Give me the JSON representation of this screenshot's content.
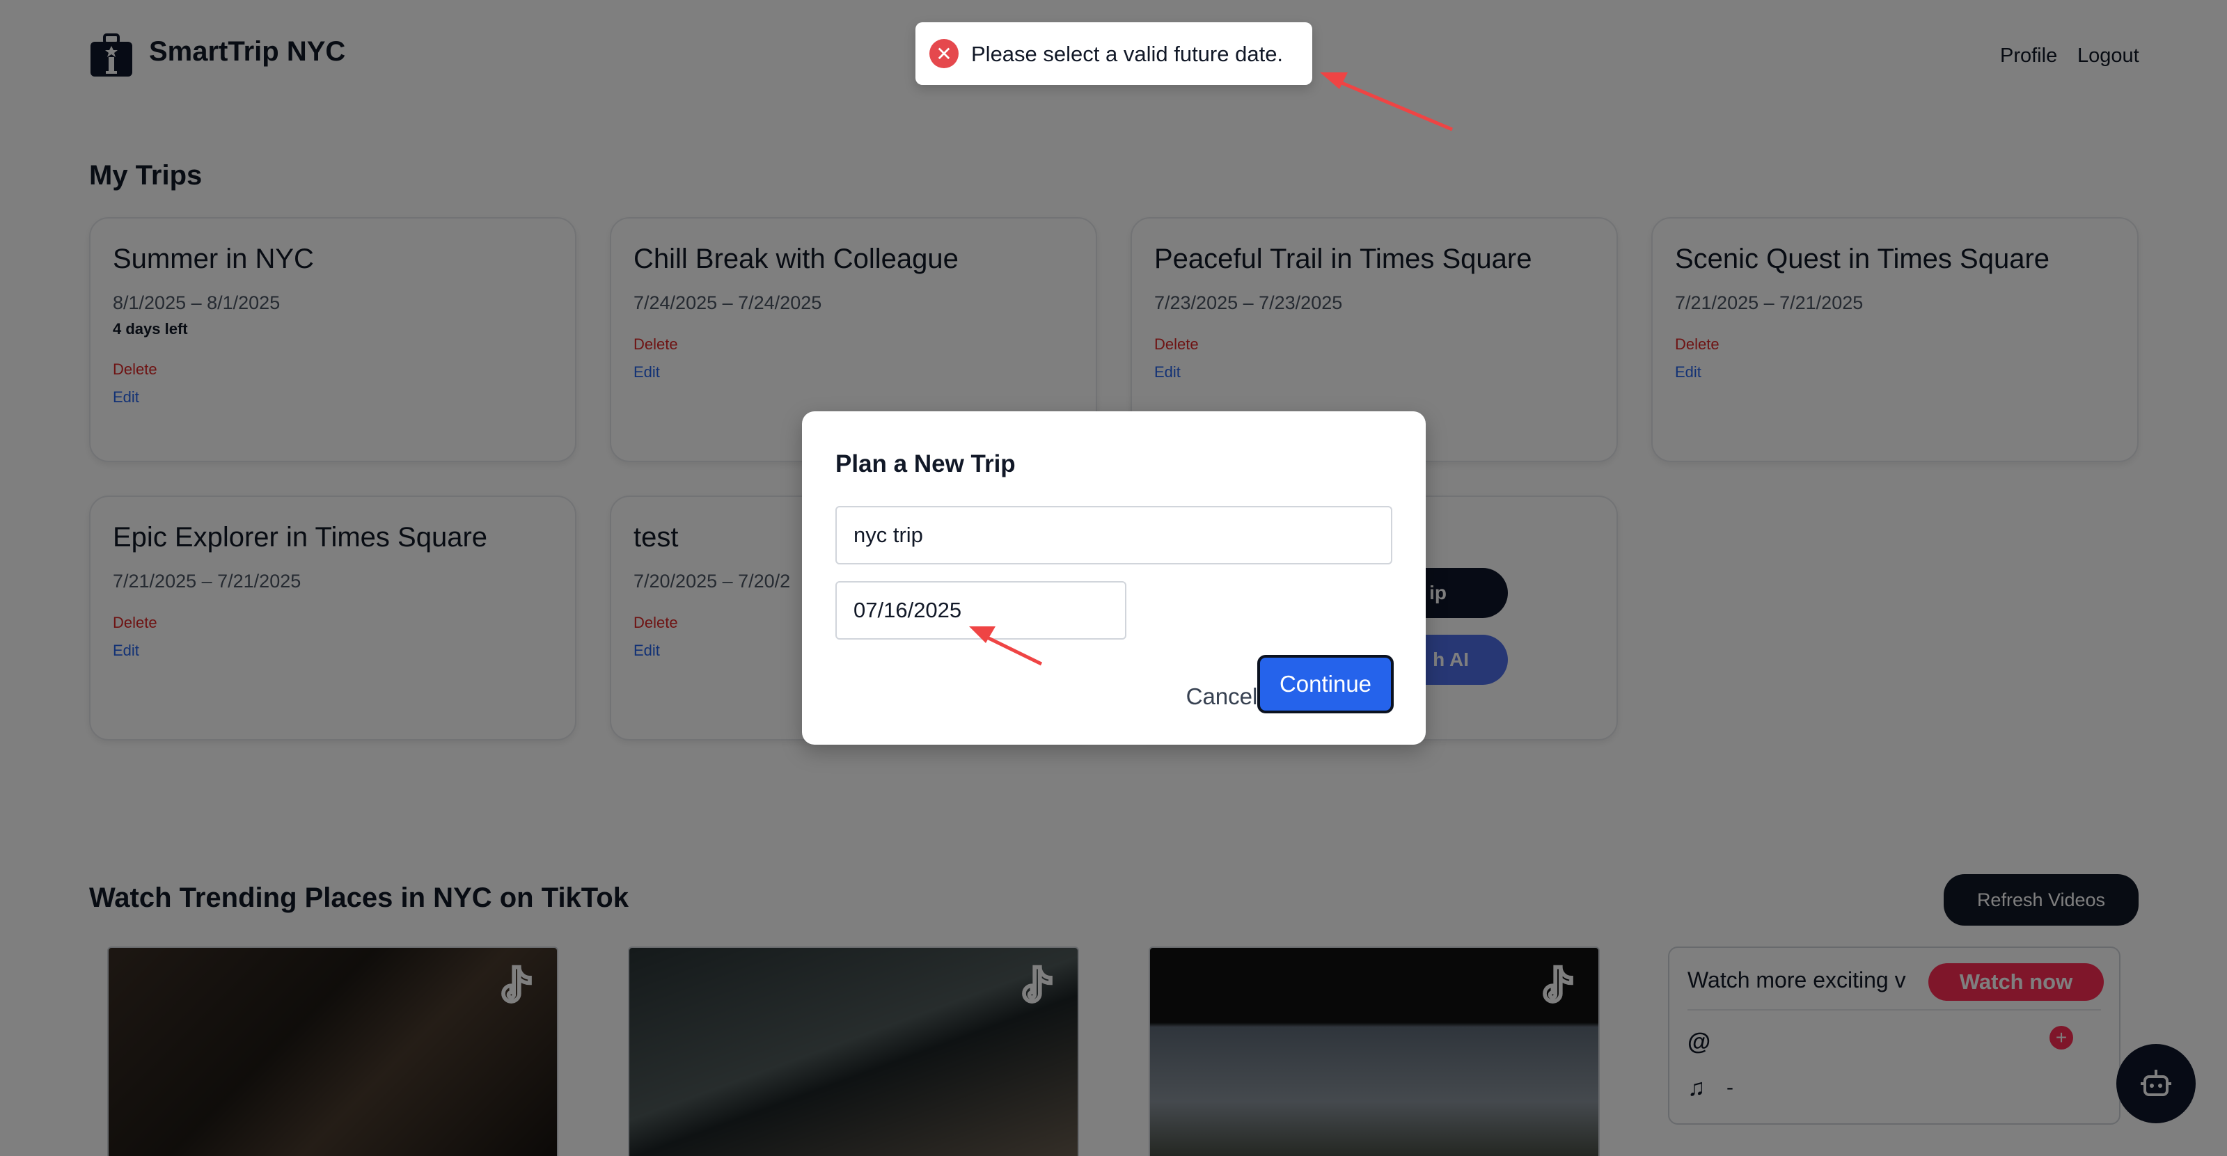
{
  "app": {
    "brand": "SmartTrip NYC"
  },
  "nav": {
    "profile": "Profile",
    "logout": "Logout"
  },
  "trips": {
    "title": "My Trips",
    "cards": [
      {
        "title": "Summer in NYC",
        "dates": "8/1/2025 – 8/1/2025",
        "days_left": "4 days left",
        "delete": "Delete",
        "edit": "Edit"
      },
      {
        "title": "Chill Break with Colleague",
        "dates": "7/24/2025 – 7/24/2025",
        "delete": "Delete",
        "edit": "Edit"
      },
      {
        "title": "Peaceful Trail in Times Square",
        "dates": "7/23/2025 – 7/23/2025",
        "delete": "Delete",
        "edit": "Edit"
      },
      {
        "title": "Scenic Quest in Times Square",
        "dates": "7/21/2025 – 7/21/2025",
        "delete": "Delete",
        "edit": "Edit"
      },
      {
        "title": "Epic Explorer in Times Square",
        "dates": "7/21/2025 – 7/21/2025",
        "delete": "Delete",
        "edit": "Edit"
      },
      {
        "title": "test",
        "dates": "7/20/2025 – 7/20/2",
        "delete": "Delete",
        "edit": "Edit"
      }
    ],
    "partial_buttons": {
      "new_trip": "ip",
      "ai": "h AI"
    }
  },
  "videos": {
    "title": "Watch Trending Places in NYC on TikTok",
    "refresh": "Refresh Videos",
    "embed": {
      "headline": "Watch more exciting v",
      "watch_now": "Watch now",
      "at": "@",
      "music_value": "-"
    }
  },
  "modal": {
    "title": "Plan a New Trip",
    "trip_name": "nyc trip",
    "date": "07/16/2025",
    "cancel": "Cancel",
    "continue": "Continue"
  },
  "toast": {
    "message": "Please select a valid future date."
  },
  "colors": {
    "primary": "#2563eb",
    "dark": "#111827",
    "danger": "#dc2626",
    "tiktok": "#fe2c55",
    "annotation": "#ef4444"
  }
}
